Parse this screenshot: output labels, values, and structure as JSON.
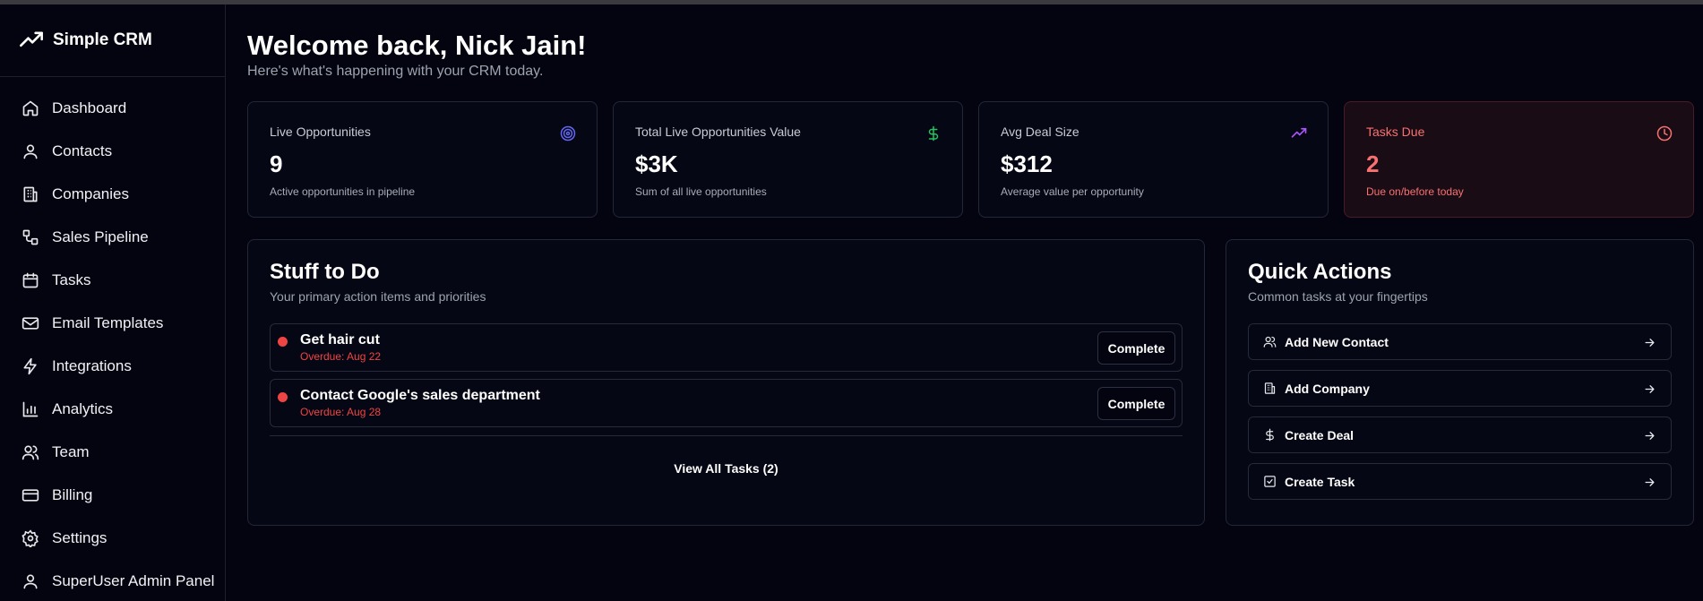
{
  "app": {
    "name": "Simple CRM"
  },
  "sidebar": {
    "items": [
      {
        "label": "Dashboard",
        "icon": "home-icon"
      },
      {
        "label": "Contacts",
        "icon": "user-icon"
      },
      {
        "label": "Companies",
        "icon": "building-icon"
      },
      {
        "label": "Sales Pipeline",
        "icon": "workflow-icon"
      },
      {
        "label": "Tasks",
        "icon": "calendar-icon"
      },
      {
        "label": "Email Templates",
        "icon": "mail-icon"
      },
      {
        "label": "Integrations",
        "icon": "zap-icon"
      },
      {
        "label": "Analytics",
        "icon": "bar-chart-icon"
      },
      {
        "label": "Team",
        "icon": "users-icon"
      },
      {
        "label": "Billing",
        "icon": "credit-card-icon"
      },
      {
        "label": "Settings",
        "icon": "gear-icon"
      },
      {
        "label": "SuperUser Admin Panel",
        "icon": "user-icon"
      }
    ]
  },
  "header": {
    "title": "Welcome back, Nick Jain!",
    "subtitle": "Here's what's happening with your CRM today."
  },
  "stats": [
    {
      "label": "Live Opportunities",
      "value": "9",
      "desc": "Active opportunities in pipeline",
      "icon": "target-icon",
      "color": "#6366f1"
    },
    {
      "label": "Total Live Opportunities Value",
      "value": "$3K",
      "desc": "Sum of all live opportunities",
      "icon": "dollar-icon",
      "color": "#22c55e"
    },
    {
      "label": "Avg Deal Size",
      "value": "$312",
      "desc": "Average value per opportunity",
      "icon": "trending-up-icon",
      "color": "#a855f7"
    },
    {
      "label": "Tasks Due",
      "value": "2",
      "desc": "Due on/before today",
      "icon": "clock-icon",
      "color": "#f87171"
    }
  ],
  "todo": {
    "title": "Stuff to Do",
    "subtitle": "Your primary action items and priorities",
    "tasks": [
      {
        "title": "Get hair cut",
        "due": "Overdue: Aug 22",
        "button": "Complete"
      },
      {
        "title": "Contact Google's sales department",
        "due": "Overdue: Aug 28",
        "button": "Complete"
      }
    ],
    "view_all": "View All Tasks (2)"
  },
  "quick_actions": {
    "title": "Quick Actions",
    "subtitle": "Common tasks at your fingertips",
    "items": [
      {
        "label": "Add New Contact",
        "icon": "user-plus-icon"
      },
      {
        "label": "Add Company",
        "icon": "building-icon"
      },
      {
        "label": "Create Deal",
        "icon": "dollar-icon"
      },
      {
        "label": "Create Task",
        "icon": "check-square-icon"
      }
    ]
  },
  "colors": {
    "background": "#03040f",
    "danger": "#ef4444",
    "border": "#23273a"
  }
}
